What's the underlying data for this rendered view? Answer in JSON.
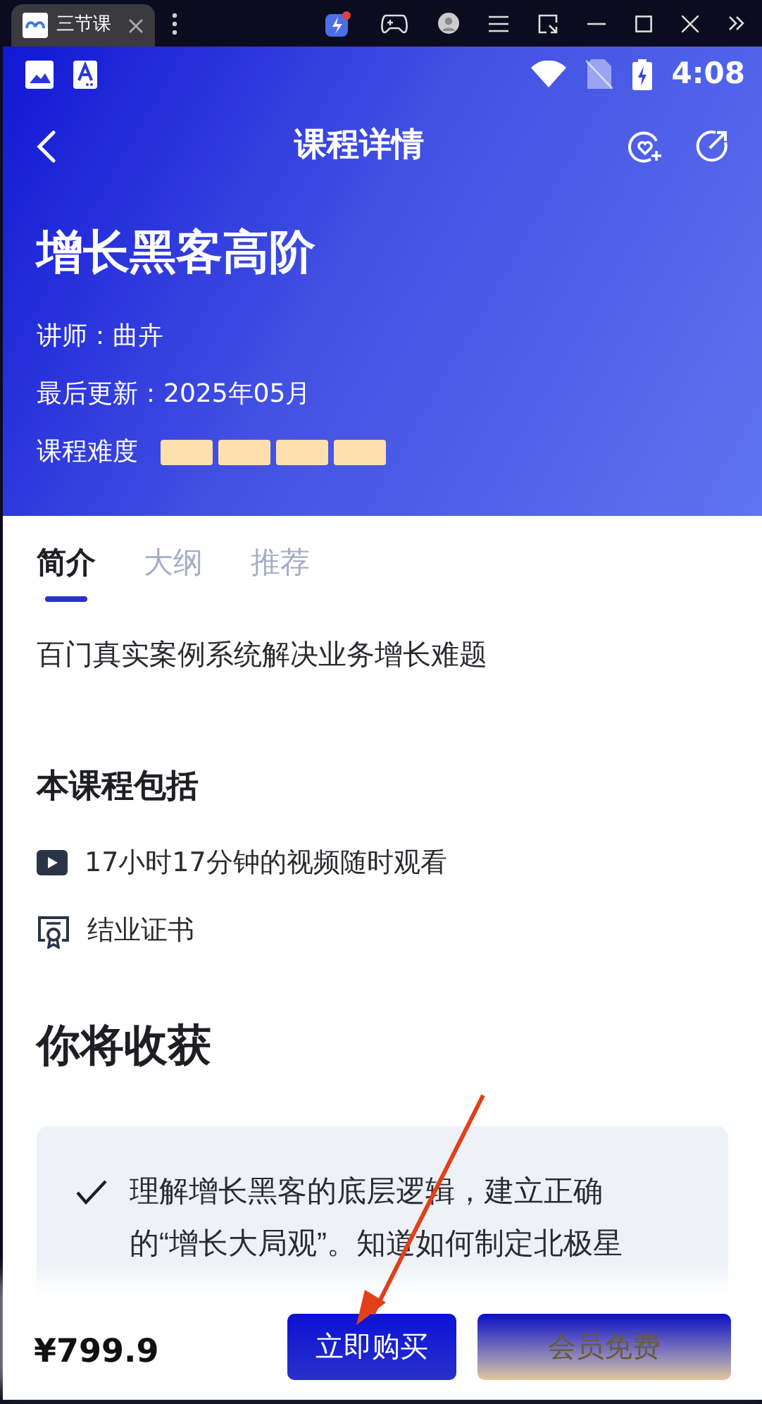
{
  "window": {
    "tab_title": "三节课"
  },
  "status_bar": {
    "time": "4:08"
  },
  "header": {
    "title": "课程详情"
  },
  "course": {
    "title": "增长黑客高阶",
    "teacher": "讲师：曲卉",
    "updated": "最后更新：2025年05月",
    "difficulty": {
      "label": "课程难度",
      "stars": 4
    }
  },
  "tabs": [
    {
      "label": "简介",
      "selected": true
    },
    {
      "label": "大纲",
      "selected": false
    },
    {
      "label": "推荐",
      "selected": false
    }
  ],
  "summary": "百门真实案例系统解决业务增长难题",
  "includes": {
    "title": "本课程包括",
    "items": [
      {
        "kind": "video",
        "text": "17小时17分钟的视频随时观看"
      },
      {
        "kind": "certificate",
        "text": "结业证书"
      }
    ]
  },
  "gains": {
    "title": "你将收获",
    "items": [
      {
        "text": "理解增长黑客的底层逻辑，建立正确的“增长大局观”。知道如何制定北极星"
      }
    ]
  },
  "bottom_bar": {
    "price": "¥799.9",
    "buy": "立即购买",
    "member": "会员免费"
  }
}
